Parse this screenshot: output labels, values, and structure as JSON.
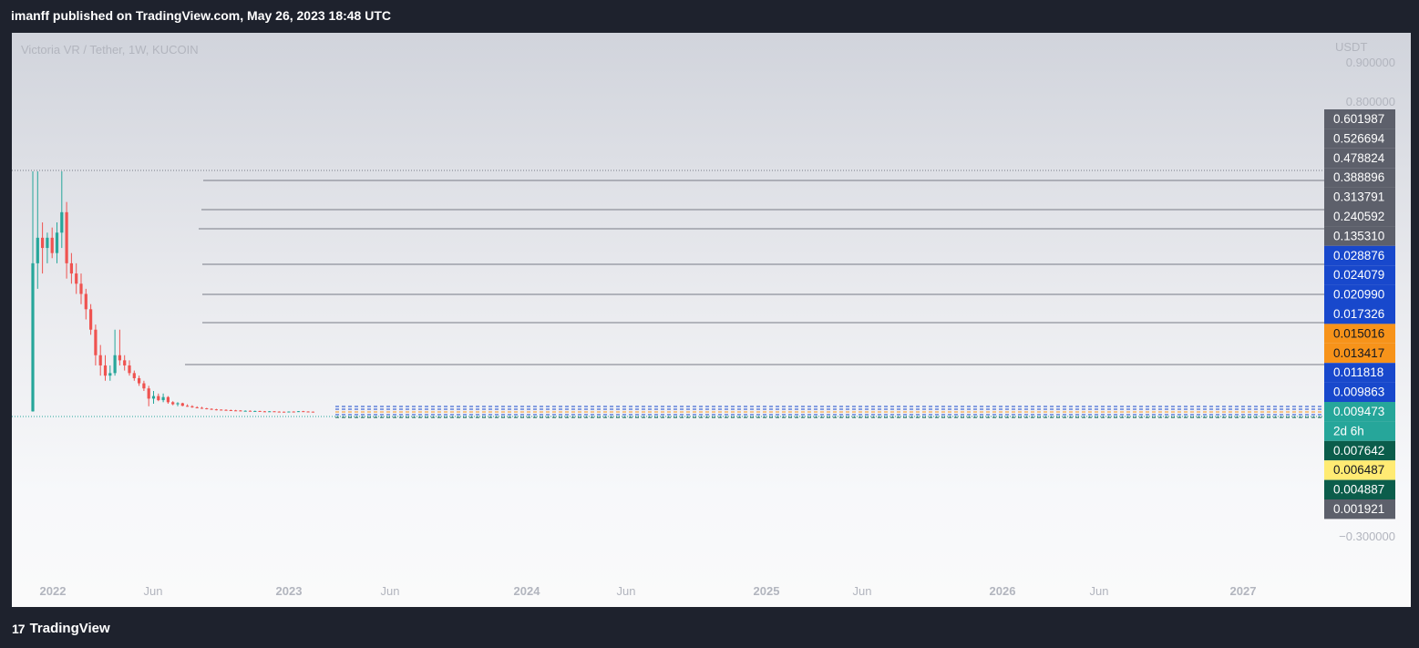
{
  "header": {
    "publish_text": "imanff published on TradingView.com, May 26, 2023 18:48 UTC"
  },
  "chart_header": {
    "symbol_title": "Victoria VR / Tether, 1W, KUCOIN",
    "currency": "USDT"
  },
  "footer": {
    "brand": "TradingView"
  },
  "colors": {
    "up": "#26a69a",
    "down": "#ef5350",
    "grey_label": "#5d606b",
    "blue_label": "#1848cc",
    "orange_label": "#f7931a",
    "teal_label": "#26a69a",
    "dark_green_label": "#0b5d4b",
    "yellow_label": "#ffeb73"
  },
  "chart_data": {
    "type": "candlestick",
    "title": "Victoria VR / Tether, 1W, KUCOIN",
    "x_ticks": [
      {
        "label": "2022",
        "bold": true
      },
      {
        "label": "Jun",
        "bold": false
      },
      {
        "label": "2023",
        "bold": true
      },
      {
        "label": "Jun",
        "bold": false
      },
      {
        "label": "2024",
        "bold": true
      },
      {
        "label": "Jun",
        "bold": false
      },
      {
        "label": "2025",
        "bold": true
      },
      {
        "label": "Jun",
        "bold": false
      },
      {
        "label": "2026",
        "bold": true
      },
      {
        "label": "Jun",
        "bold": false
      },
      {
        "label": "2027",
        "bold": true
      }
    ],
    "y_ticks": [
      "0.900000",
      "0.800000",
      "−0.300000"
    ],
    "price_labels": [
      {
        "value": "0.601987",
        "style": "grey"
      },
      {
        "value": "0.526694",
        "style": "grey"
      },
      {
        "value": "0.478824",
        "style": "grey"
      },
      {
        "value": "0.388896",
        "style": "grey"
      },
      {
        "value": "0.313791",
        "style": "grey"
      },
      {
        "value": "0.240592",
        "style": "grey"
      },
      {
        "value": "0.135310",
        "style": "grey"
      },
      {
        "value": "0.028876",
        "style": "blue"
      },
      {
        "value": "0.024079",
        "style": "blue"
      },
      {
        "value": "0.020990",
        "style": "blue"
      },
      {
        "value": "0.017326",
        "style": "blue"
      },
      {
        "value": "0.015016",
        "style": "orange"
      },
      {
        "value": "0.013417",
        "style": "orange"
      },
      {
        "value": "0.011818",
        "style": "blue"
      },
      {
        "value": "0.009863",
        "style": "blue"
      },
      {
        "value": "0.009473",
        "style": "teal"
      },
      {
        "value": "2d 6h",
        "style": "teal"
      },
      {
        "value": "0.007642",
        "style": "darkgreen"
      },
      {
        "value": "0.006487",
        "style": "yellow"
      },
      {
        "value": "0.004887",
        "style": "darkgreen"
      },
      {
        "value": "0.001921",
        "style": "grey"
      }
    ],
    "candles": [
      {
        "o": 0.01,
        "h": 0.48,
        "l": 0.0095,
        "c": 0.3,
        "up": true
      },
      {
        "o": 0.3,
        "h": 0.48,
        "l": 0.25,
        "c": 0.35,
        "up": true
      },
      {
        "o": 0.35,
        "h": 0.38,
        "l": 0.28,
        "c": 0.33,
        "up": false
      },
      {
        "o": 0.33,
        "h": 0.36,
        "l": 0.3,
        "c": 0.35,
        "up": true
      },
      {
        "o": 0.35,
        "h": 0.37,
        "l": 0.31,
        "c": 0.32,
        "up": false
      },
      {
        "o": 0.32,
        "h": 0.38,
        "l": 0.3,
        "c": 0.36,
        "up": true
      },
      {
        "o": 0.36,
        "h": 0.48,
        "l": 0.33,
        "c": 0.4,
        "up": true
      },
      {
        "o": 0.4,
        "h": 0.42,
        "l": 0.27,
        "c": 0.3,
        "up": false
      },
      {
        "o": 0.3,
        "h": 0.32,
        "l": 0.26,
        "c": 0.28,
        "up": false
      },
      {
        "o": 0.28,
        "h": 0.3,
        "l": 0.24,
        "c": 0.26,
        "up": false
      },
      {
        "o": 0.26,
        "h": 0.28,
        "l": 0.22,
        "c": 0.24,
        "up": false
      },
      {
        "o": 0.24,
        "h": 0.25,
        "l": 0.19,
        "c": 0.21,
        "up": false
      },
      {
        "o": 0.21,
        "h": 0.22,
        "l": 0.16,
        "c": 0.17,
        "up": false
      },
      {
        "o": 0.17,
        "h": 0.18,
        "l": 0.1,
        "c": 0.12,
        "up": false
      },
      {
        "o": 0.12,
        "h": 0.14,
        "l": 0.08,
        "c": 0.1,
        "up": false
      },
      {
        "o": 0.1,
        "h": 0.12,
        "l": 0.07,
        "c": 0.08,
        "up": false
      },
      {
        "o": 0.08,
        "h": 0.1,
        "l": 0.07,
        "c": 0.085,
        "up": true
      },
      {
        "o": 0.085,
        "h": 0.17,
        "l": 0.08,
        "c": 0.12,
        "up": true
      },
      {
        "o": 0.12,
        "h": 0.17,
        "l": 0.1,
        "c": 0.11,
        "up": false
      },
      {
        "o": 0.11,
        "h": 0.12,
        "l": 0.09,
        "c": 0.1,
        "up": false
      },
      {
        "o": 0.1,
        "h": 0.11,
        "l": 0.08,
        "c": 0.085,
        "up": false
      },
      {
        "o": 0.085,
        "h": 0.09,
        "l": 0.07,
        "c": 0.075,
        "up": false
      },
      {
        "o": 0.075,
        "h": 0.08,
        "l": 0.06,
        "c": 0.065,
        "up": false
      },
      {
        "o": 0.065,
        "h": 0.07,
        "l": 0.05,
        "c": 0.055,
        "up": false
      },
      {
        "o": 0.055,
        "h": 0.06,
        "l": 0.02,
        "c": 0.035,
        "up": false
      },
      {
        "o": 0.035,
        "h": 0.05,
        "l": 0.025,
        "c": 0.04,
        "up": true
      },
      {
        "o": 0.04,
        "h": 0.045,
        "l": 0.03,
        "c": 0.032,
        "up": false
      },
      {
        "o": 0.032,
        "h": 0.045,
        "l": 0.028,
        "c": 0.038,
        "up": true
      },
      {
        "o": 0.038,
        "h": 0.04,
        "l": 0.025,
        "c": 0.028,
        "up": false
      },
      {
        "o": 0.028,
        "h": 0.03,
        "l": 0.022,
        "c": 0.024,
        "up": false
      },
      {
        "o": 0.024,
        "h": 0.028,
        "l": 0.02,
        "c": 0.026,
        "up": true
      },
      {
        "o": 0.026,
        "h": 0.027,
        "l": 0.02,
        "c": 0.021,
        "up": false
      },
      {
        "o": 0.021,
        "h": 0.024,
        "l": 0.019,
        "c": 0.02,
        "up": false
      },
      {
        "o": 0.02,
        "h": 0.022,
        "l": 0.017,
        "c": 0.018,
        "up": false
      },
      {
        "o": 0.018,
        "h": 0.02,
        "l": 0.016,
        "c": 0.017,
        "up": false
      },
      {
        "o": 0.017,
        "h": 0.019,
        "l": 0.015,
        "c": 0.016,
        "up": false
      },
      {
        "o": 0.016,
        "h": 0.017,
        "l": 0.014,
        "c": 0.015,
        "up": false
      },
      {
        "o": 0.015,
        "h": 0.016,
        "l": 0.013,
        "c": 0.014,
        "up": false
      },
      {
        "o": 0.014,
        "h": 0.015,
        "l": 0.012,
        "c": 0.0135,
        "up": false
      },
      {
        "o": 0.0135,
        "h": 0.014,
        "l": 0.012,
        "c": 0.013,
        "up": false
      },
      {
        "o": 0.013,
        "h": 0.014,
        "l": 0.0115,
        "c": 0.0125,
        "up": false
      },
      {
        "o": 0.0125,
        "h": 0.0135,
        "l": 0.011,
        "c": 0.012,
        "up": false
      },
      {
        "o": 0.012,
        "h": 0.013,
        "l": 0.011,
        "c": 0.0118,
        "up": false
      },
      {
        "o": 0.0118,
        "h": 0.0125,
        "l": 0.0105,
        "c": 0.011,
        "up": false
      },
      {
        "o": 0.011,
        "h": 0.012,
        "l": 0.0103,
        "c": 0.0112,
        "up": true
      },
      {
        "o": 0.0112,
        "h": 0.0118,
        "l": 0.0102,
        "c": 0.0105,
        "up": false
      },
      {
        "o": 0.0105,
        "h": 0.0115,
        "l": 0.01,
        "c": 0.0108,
        "up": true
      },
      {
        "o": 0.0108,
        "h": 0.0112,
        "l": 0.0098,
        "c": 0.0101,
        "up": false
      },
      {
        "o": 0.0101,
        "h": 0.0108,
        "l": 0.0096,
        "c": 0.0099,
        "up": false
      },
      {
        "o": 0.0099,
        "h": 0.0106,
        "l": 0.0095,
        "c": 0.0102,
        "up": true
      },
      {
        "o": 0.0102,
        "h": 0.0105,
        "l": 0.0093,
        "c": 0.0096,
        "up": false
      },
      {
        "o": 0.0096,
        "h": 0.0102,
        "l": 0.0092,
        "c": 0.0094,
        "up": false
      },
      {
        "o": 0.0094,
        "h": 0.0098,
        "l": 0.009,
        "c": 0.0093,
        "up": false
      },
      {
        "o": 0.0093,
        "h": 0.01,
        "l": 0.009,
        "c": 0.0097,
        "up": true
      },
      {
        "o": 0.0097,
        "h": 0.0102,
        "l": 0.0092,
        "c": 0.0095,
        "up": false
      },
      {
        "o": 0.0095,
        "h": 0.0108,
        "l": 0.0093,
        "c": 0.0104,
        "up": true
      },
      {
        "o": 0.0104,
        "h": 0.011,
        "l": 0.0095,
        "c": 0.0098,
        "up": false
      },
      {
        "o": 0.0098,
        "h": 0.0103,
        "l": 0.0093,
        "c": 0.0095,
        "up": false
      },
      {
        "o": 0.0095,
        "h": 0.0099,
        "l": 0.0091,
        "c": 0.00947,
        "up": false
      }
    ]
  }
}
